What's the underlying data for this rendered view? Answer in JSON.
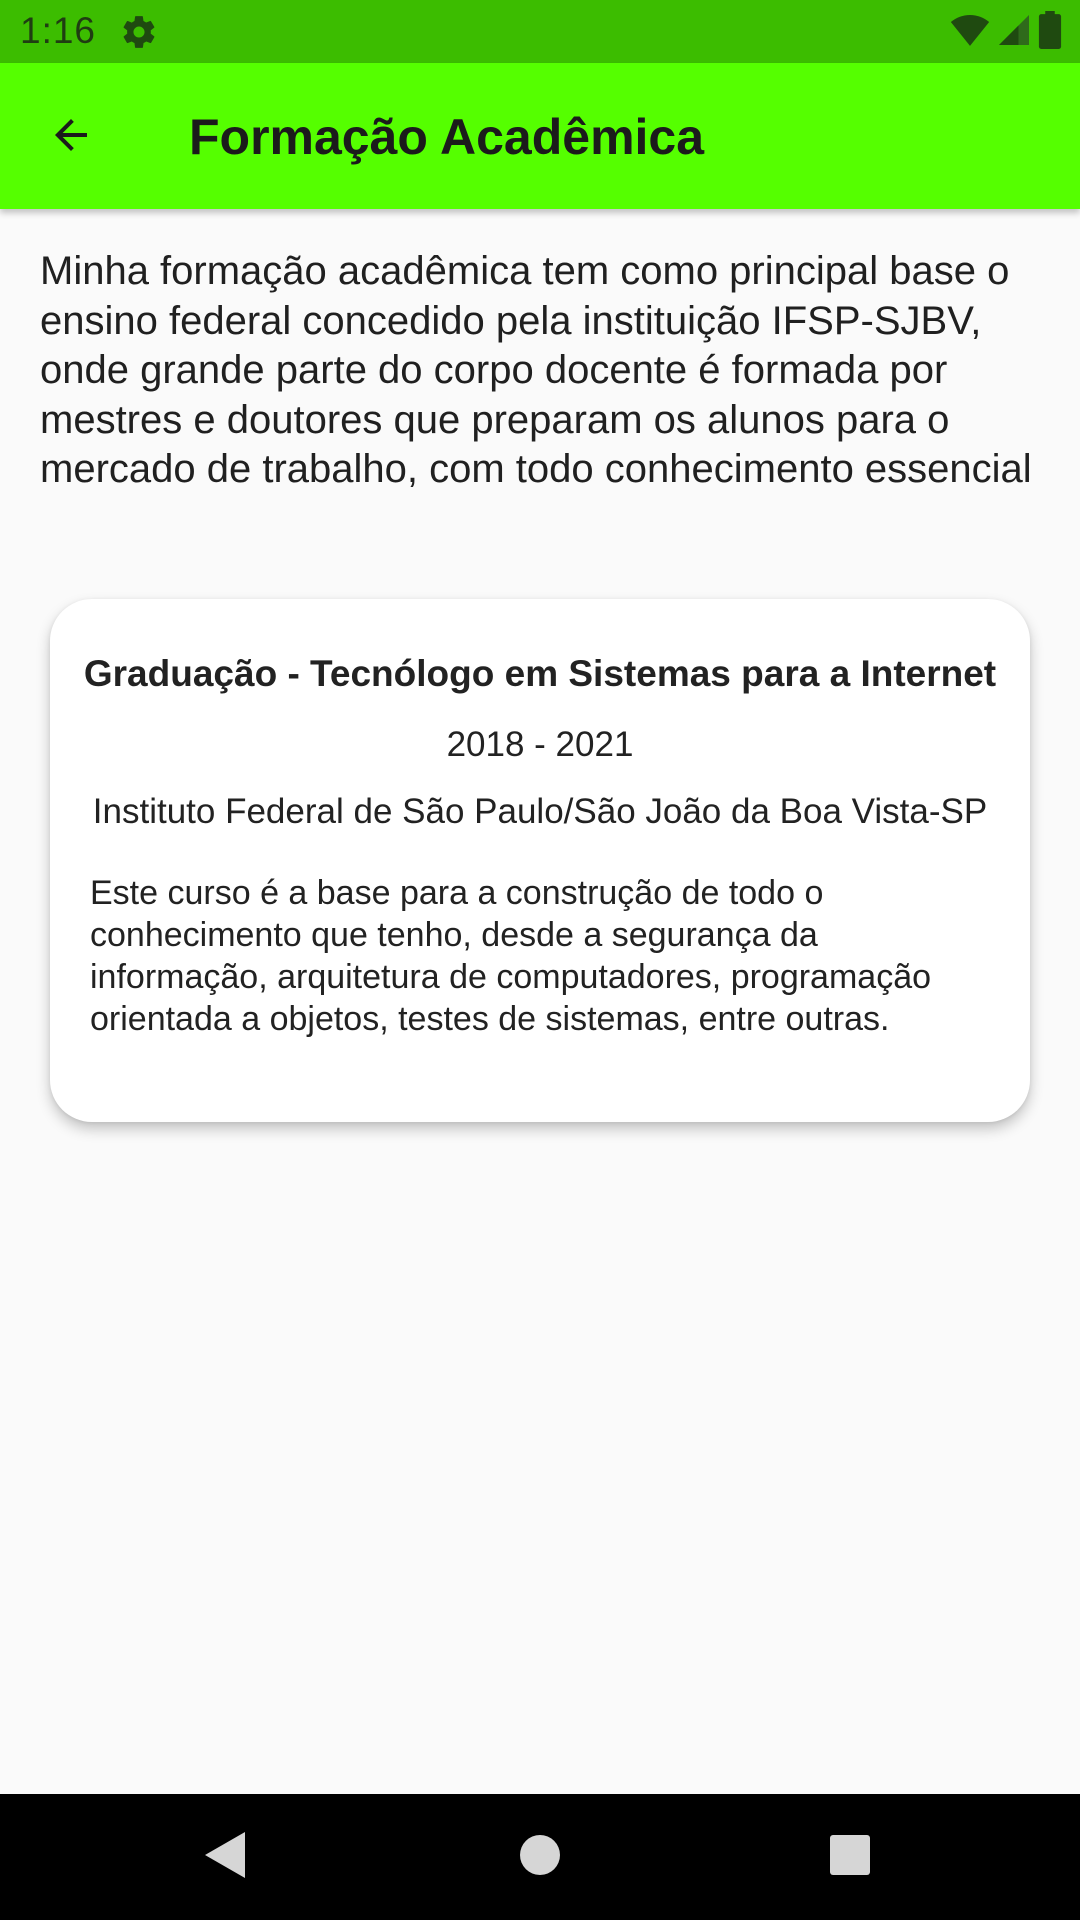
{
  "status_bar": {
    "time": "1:16",
    "icons": [
      "settings-gear-icon",
      "wifi-icon",
      "cellular-signal-icon",
      "battery-icon"
    ]
  },
  "app_bar": {
    "back_icon": "arrow-back-icon",
    "title": "Formação Acadêmica"
  },
  "intro": {
    "text": "Minha formação acadêmica tem como principal base o ensino federal concedido pela instituição IFSP-SJBV, onde grande parte do corpo docente é formada por mestres e doutores que preparam os alunos para o mercado de trabalho, com todo conhecimento essencial"
  },
  "card": {
    "title": "Graduação - Tecnólogo em Sistemas para a Internet",
    "years": "2018 - 2021",
    "institution": "Instituto Federal de São Paulo/São João da Boa Vista-SP",
    "description": "Este curso é a base para a construção de todo o conhecimento que tenho, desde a segurança da informação, arquitetura de computadores, programação orientada a objetos, testes de sistemas, entre outras."
  },
  "nav_bar": {
    "icons": [
      "nav-back-icon",
      "nav-home-icon",
      "nav-recents-icon"
    ]
  },
  "colors": {
    "status_bar": "#3cbd00",
    "app_bar": "#55ff00",
    "background": "#fafafa",
    "card": "#ffffff",
    "nav_bar": "#000000"
  }
}
